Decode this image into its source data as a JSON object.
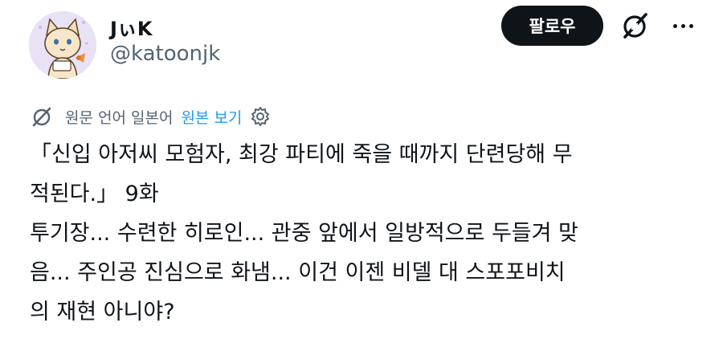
{
  "user": {
    "display_name": "JぃK",
    "handle": "@katoonjk",
    "avatar_icon": "cat-avatar-icon"
  },
  "actions": {
    "follow_label": "팔로우",
    "grok_icon": "grok-icon",
    "more_icon": "more-dots-icon"
  },
  "translation": {
    "icon": "grok-translate-icon",
    "label": "원문 언어 일본어",
    "show_original_label": "원본 보기",
    "settings_icon": "gear-icon"
  },
  "post": {
    "lines": [
      "「신입 아저씨 모험자, 최강 파티에 죽을 때까지 단련당해 무",
      "적된다.」 9화",
      "투기장... 수련한 히로인... 관중 앞에서 일방적으로 두들겨 맞",
      "음... 주인공 진심으로 화냄... 이건 이젠 비델 대 스포포비치",
      "의 재현 아니야?"
    ]
  },
  "colors": {
    "text_primary": "#0f1419",
    "text_secondary": "#536471",
    "link": "#1d9bf0",
    "follow_bg": "#0f1419",
    "avatar_bg": "#e9e1f4"
  }
}
